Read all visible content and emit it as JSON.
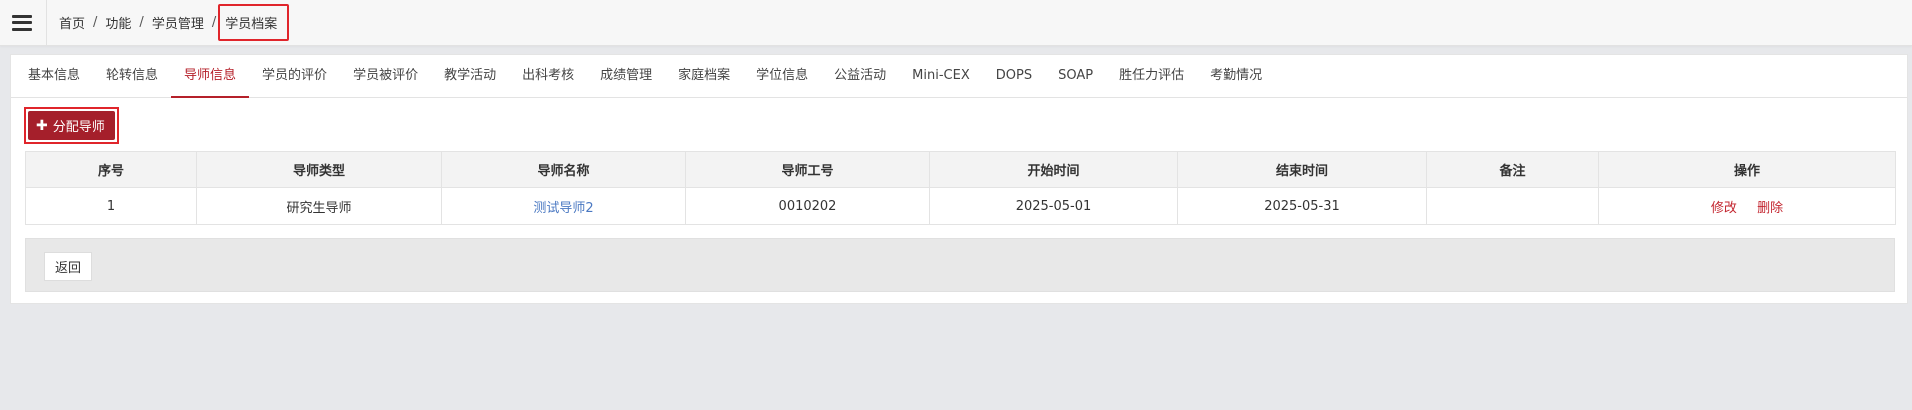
{
  "breadcrumb": {
    "items": [
      "首页",
      "功能",
      "学员管理",
      "学员档案"
    ],
    "separator": "/"
  },
  "tabs": [
    {
      "label": "基本信息",
      "active": false
    },
    {
      "label": "轮转信息",
      "active": false
    },
    {
      "label": "导师信息",
      "active": true
    },
    {
      "label": "学员的评价",
      "active": false
    },
    {
      "label": "学员被评价",
      "active": false
    },
    {
      "label": "教学活动",
      "active": false
    },
    {
      "label": "出科考核",
      "active": false
    },
    {
      "label": "成绩管理",
      "active": false
    },
    {
      "label": "家庭档案",
      "active": false
    },
    {
      "label": "学位信息",
      "active": false
    },
    {
      "label": "公益活动",
      "active": false
    },
    {
      "label": "Mini-CEX",
      "active": false
    },
    {
      "label": "DOPS",
      "active": false
    },
    {
      "label": "SOAP",
      "active": false
    },
    {
      "label": "胜任力评估",
      "active": false
    },
    {
      "label": "考勤情况",
      "active": false
    }
  ],
  "toolbar": {
    "assign_label": "分配导师",
    "assign_icon": "plus-icon"
  },
  "table": {
    "headers": [
      "序号",
      "导师类型",
      "导师名称",
      "导师工号",
      "开始时间",
      "结束时间",
      "备注",
      "操作"
    ],
    "rows": [
      {
        "index": "1",
        "type": "研究生导师",
        "name": "测试导师2",
        "employee_id": "0010202",
        "start": "2025-05-01",
        "end": "2025-05-31",
        "remark": "",
        "actions": {
          "edit": "修改",
          "delete": "删除"
        }
      }
    ]
  },
  "footer": {
    "back_label": "返回"
  },
  "colors": {
    "accent": "#a51f2b",
    "active_tab": "#b5202a",
    "link": "#4a78c2",
    "highlight_border": "#e0252b"
  }
}
